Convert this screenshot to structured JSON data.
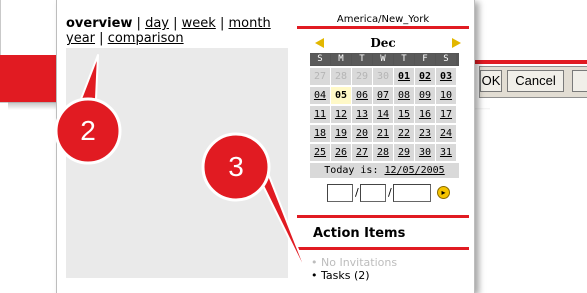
{
  "background_dialog": {
    "ok_label": "OK",
    "cancel_label": "Cancel"
  },
  "nav": {
    "current": "overview",
    "separator": "|",
    "links": [
      "day",
      "week",
      "month",
      "year",
      "comparison"
    ]
  },
  "sidebar": {
    "timezone": "America/New_York",
    "calendar": {
      "month": "Dec",
      "prev_icon": "triangle-left-icon",
      "next_icon": "triangle-right-icon",
      "weekdays": [
        "S",
        "M",
        "T",
        "W",
        "T",
        "F",
        "S"
      ],
      "weeks": [
        [
          "27",
          "28",
          "29",
          "30",
          "01",
          "02",
          "03"
        ],
        [
          "04",
          "05",
          "06",
          "07",
          "08",
          "09",
          "10"
        ],
        [
          "11",
          "12",
          "13",
          "14",
          "15",
          "16",
          "17"
        ],
        [
          "18",
          "19",
          "20",
          "21",
          "22",
          "23",
          "24"
        ],
        [
          "25",
          "26",
          "27",
          "28",
          "29",
          "30",
          "31"
        ]
      ],
      "today_label": "Today is:",
      "today_value": "12/05/2005"
    },
    "date_separator": "/",
    "go_icon": "go-arrow-icon",
    "action_items": {
      "title": "Action Items",
      "items": [
        {
          "text": "No Invitations",
          "enabled": false
        },
        {
          "text": "Tasks (2)",
          "enabled": true
        }
      ]
    }
  },
  "callouts": [
    "2",
    "3"
  ],
  "colors": {
    "accent_red": "#e11b22",
    "arrow_yellow": "#e2b700",
    "today_highlight": "#fff9c7",
    "content_gray": "#eaeaea",
    "cell_gray": "#d9d9d9"
  }
}
